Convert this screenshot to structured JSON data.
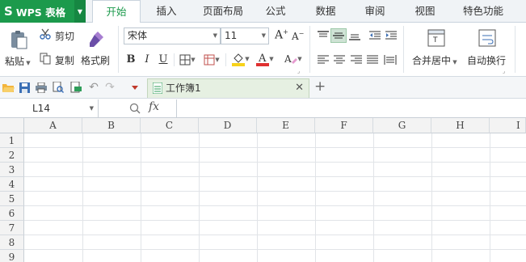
{
  "app": {
    "name": "WPS 表格",
    "logo": "S"
  },
  "menu": {
    "tabs": [
      "开始",
      "插入",
      "页面布局",
      "公式",
      "数据",
      "审阅",
      "视图",
      "特色功能"
    ],
    "active_tab": "开始"
  },
  "ribbon": {
    "paste_label": "粘贴",
    "cut_label": "剪切",
    "copy_label": "复制",
    "format_painter_label": "格式刷",
    "font_name": "宋体",
    "font_size": "11",
    "merge_label": "合并居中",
    "wrap_label": "自动换行"
  },
  "document": {
    "tab_title": "工作簿1"
  },
  "formula_bar": {
    "cell_ref": "L14",
    "fx_label": "fx",
    "value": ""
  },
  "sheet": {
    "columns": [
      "A",
      "B",
      "C",
      "D",
      "E",
      "F",
      "G",
      "H",
      "I"
    ],
    "rows": [
      "1",
      "2",
      "3",
      "4",
      "5",
      "6",
      "7",
      "8",
      "9"
    ]
  },
  "colors": {
    "brand_green": "#1c9a4c",
    "font_color_red": "#e03030",
    "fill_yellow": "#f7d21a"
  }
}
